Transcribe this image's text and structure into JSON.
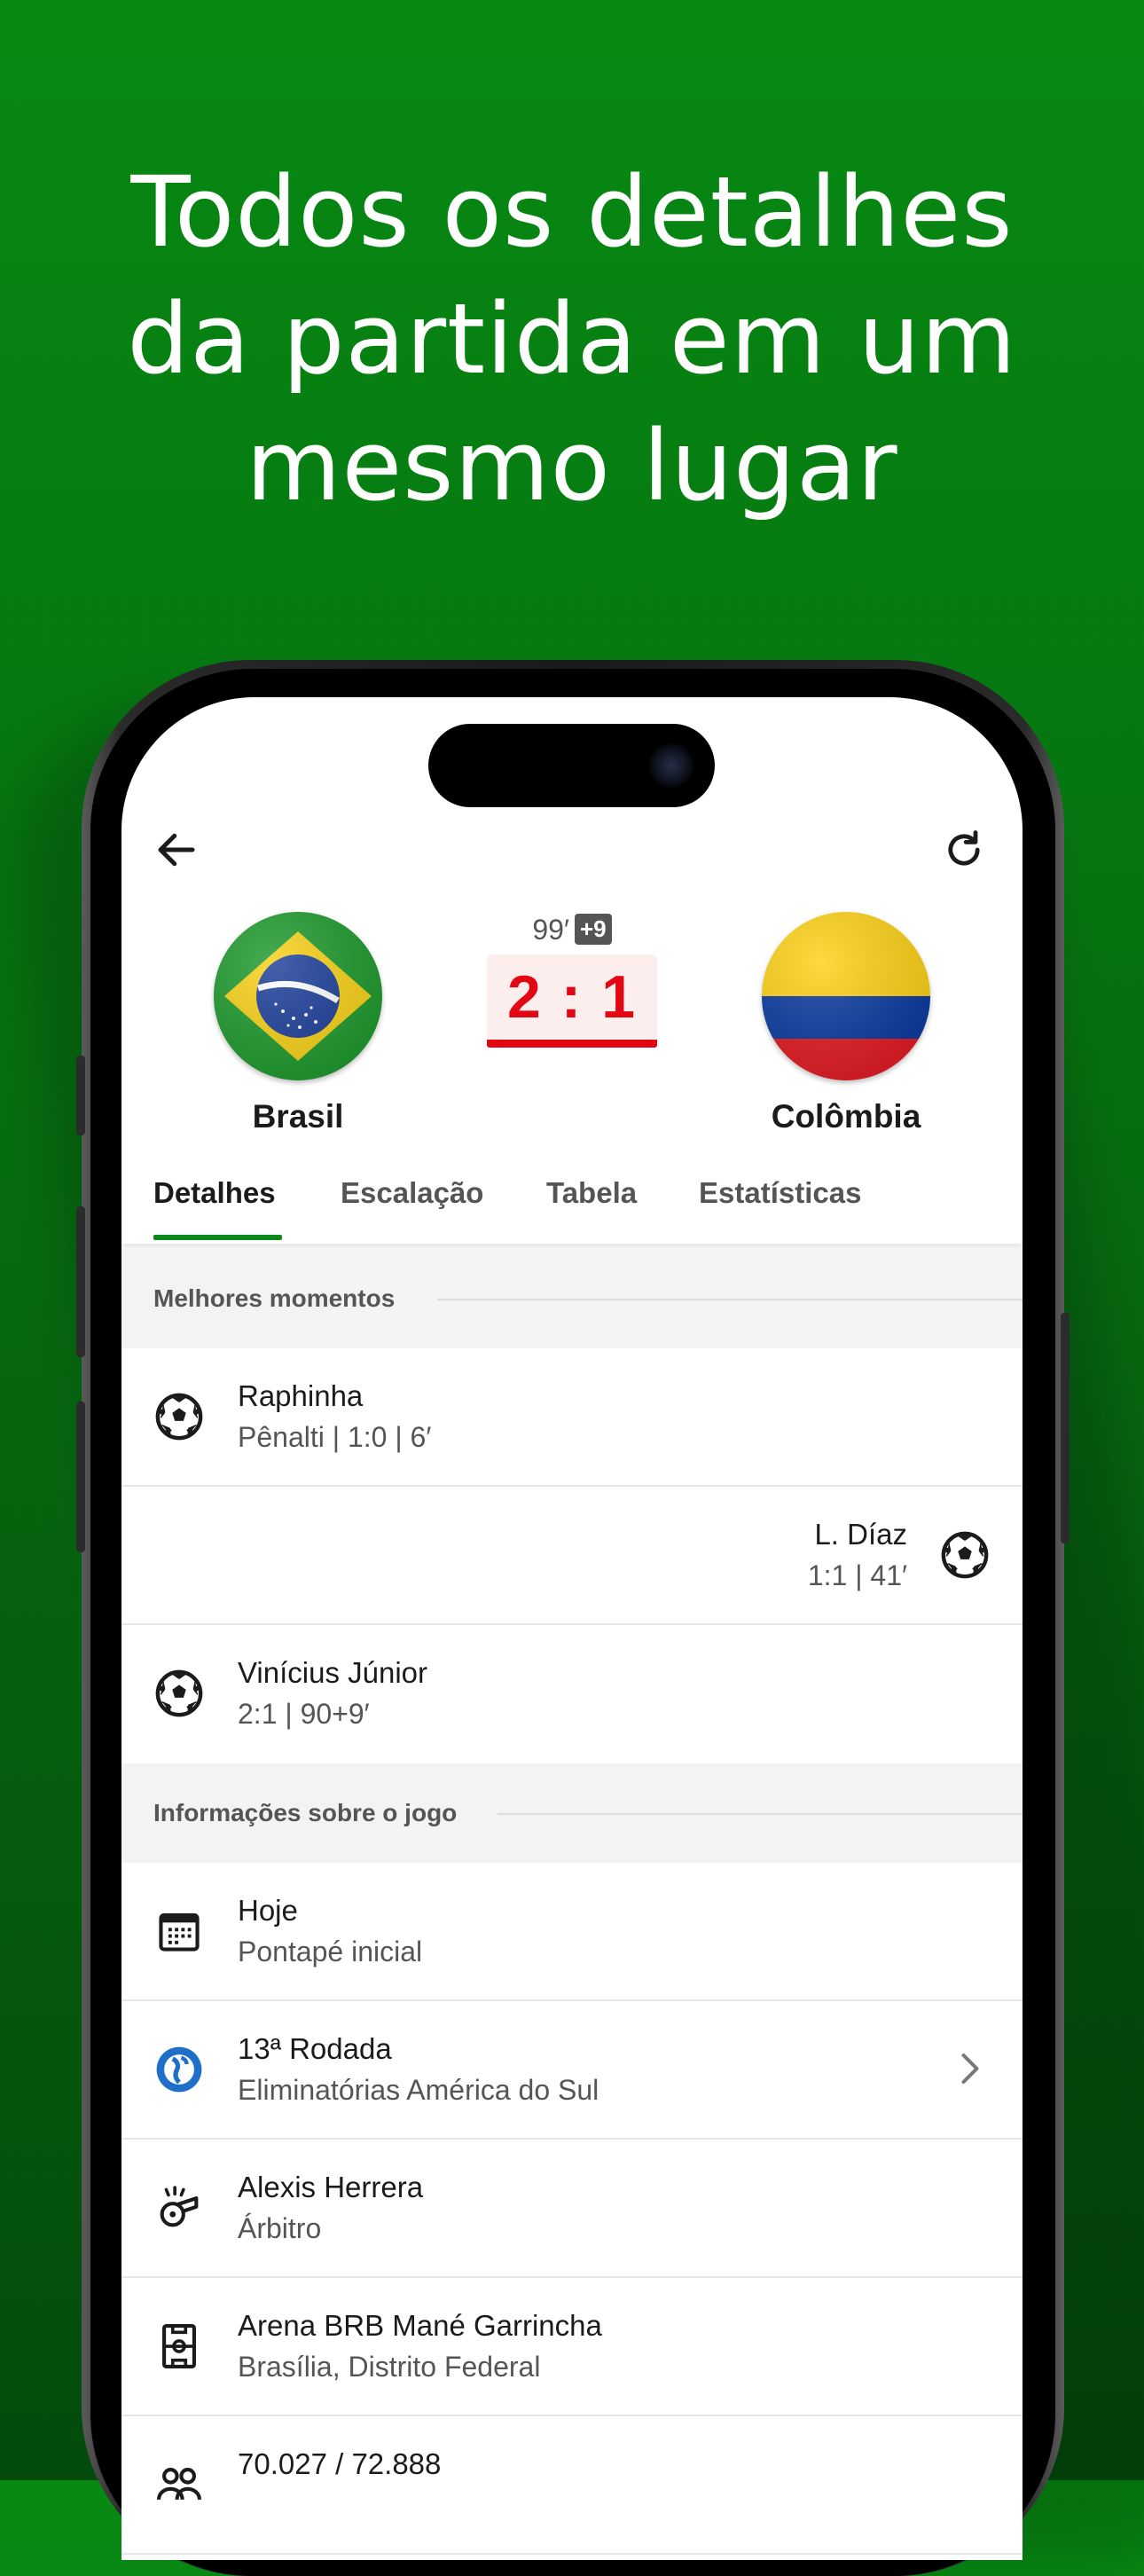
{
  "headline": [
    "Todos os detalhes",
    "da partida em um",
    "mesmo lugar"
  ],
  "match": {
    "minute": "99′",
    "added_time": "+9",
    "score": "2 : 1",
    "home_team": "Brasil",
    "away_team": "Colômbia"
  },
  "tabs": [
    "Detalhes",
    "Escalação",
    "Tabela",
    "Estatísticas"
  ],
  "highlights": {
    "heading": "Melhores momentos",
    "events": [
      {
        "player": "Raphinha",
        "detail": "Pênalti | 1:0 | 6′",
        "side": "home",
        "icon": "soccer-ball-icon"
      },
      {
        "player": "L. Díaz",
        "detail": "1:1 | 41′",
        "side": "away",
        "icon": "soccer-ball-icon"
      },
      {
        "player": "Vinícius Júnior",
        "detail": "2:1 | 90+9′",
        "side": "home",
        "icon": "soccer-ball-icon"
      }
    ]
  },
  "info": {
    "heading": "Informações sobre o jogo",
    "items": [
      {
        "title": "Hoje",
        "subtitle": "Pontapé inicial",
        "icon": "calendar-icon"
      },
      {
        "title": "13ª Rodada",
        "subtitle": "Eliminatórias América do Sul",
        "icon": "competition-globe-icon"
      },
      {
        "title": "Alexis Herrera",
        "subtitle": "Árbitro",
        "icon": "whistle-icon"
      },
      {
        "title": "Arena BRB Mané Garrincha",
        "subtitle": "Brasília, Distrito Federal",
        "icon": "stadium-icon"
      },
      {
        "title": "70.027 / 72.888",
        "subtitle": "",
        "icon": "attendance-icon"
      }
    ]
  },
  "colors": {
    "background": "#078a12",
    "score": "#e30613",
    "tab_indicator": "#0a8a1b"
  }
}
